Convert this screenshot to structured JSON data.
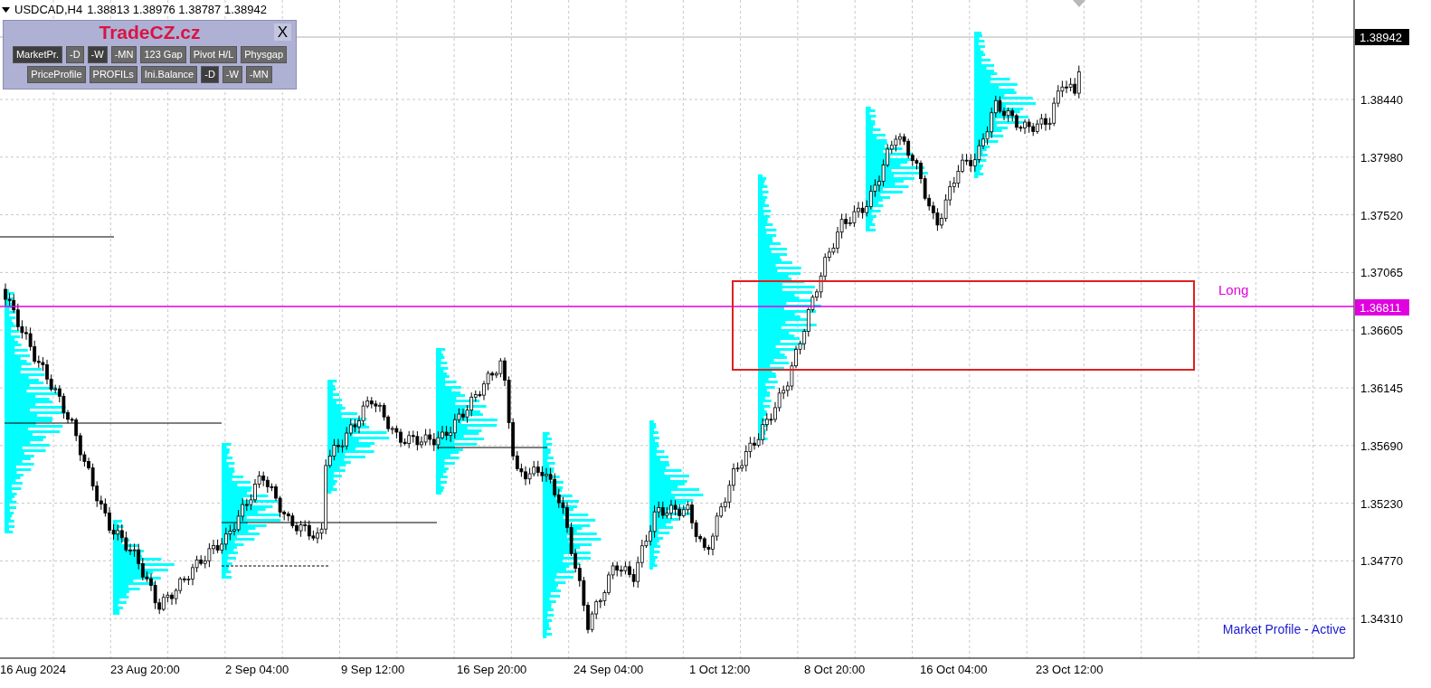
{
  "chart_header": {
    "symbol": "USDCAD,H4",
    "ohlc": "1.38813 1.38976 1.38787 1.38942"
  },
  "panel": {
    "title": "TradeCZ.cz",
    "close": "X",
    "top_buttons": [
      {
        "label": "MarketPr.",
        "selected": true
      },
      {
        "label": "-D",
        "selected": false
      },
      {
        "label": "-W",
        "selected": true
      },
      {
        "label": "-MN",
        "selected": false
      },
      {
        "label": "123 Gap",
        "selected": false
      },
      {
        "label": "Pivot H/L",
        "selected": false
      },
      {
        "label": "Physgap",
        "selected": false
      }
    ],
    "bottom_buttons": [
      {
        "label": "PriceProfile",
        "selected": false
      },
      {
        "label": "PROFILs",
        "selected": false
      },
      {
        "label": "Ini.Balance",
        "selected": false
      },
      {
        "label": "-D",
        "selected": true
      },
      {
        "label": "-W",
        "selected": false
      },
      {
        "label": "-MN",
        "selected": false
      }
    ]
  },
  "price_axis": [
    "1.38440",
    "1.37980",
    "1.37520",
    "1.37065",
    "1.36605",
    "1.36145",
    "1.35690",
    "1.35230",
    "1.34770",
    "1.34310"
  ],
  "current_price": "1.38942",
  "level_line": {
    "label": "Long",
    "price": "1.36811"
  },
  "time_axis": [
    "16 Aug 2024",
    "23 Aug 20:00",
    "2 Sep 04:00",
    "9 Sep 12:00",
    "16 Sep 20:00",
    "24 Sep 04:00",
    "1 Oct 12:00",
    "8 Oct 20:00",
    "16 Oct 04:00",
    "23 Oct 12:00"
  ],
  "status": "Market Profile - Active"
}
